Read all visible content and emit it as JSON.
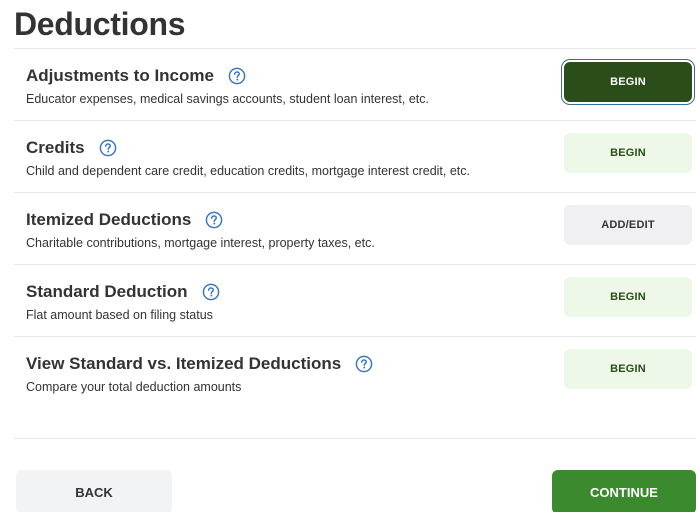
{
  "page": {
    "title": "Deductions"
  },
  "rows": [
    {
      "title": "Adjustments to Income",
      "description": "Educator expenses, medical savings accounts, student loan interest, etc.",
      "action_label": "BEGIN"
    },
    {
      "title": "Credits",
      "description": "Child and dependent care credit, education credits, mortgage interest credit, etc.",
      "action_label": "BEGIN"
    },
    {
      "title": "Itemized Deductions",
      "description": "Charitable contributions, mortgage interest, property taxes, etc.",
      "action_label": "ADD/EDIT"
    },
    {
      "title": "Standard Deduction",
      "description": "Flat amount based on filing status",
      "action_label": "BEGIN"
    },
    {
      "title": "View Standard vs. Itemized Deductions",
      "description": "Compare your total deduction amounts",
      "action_label": "BEGIN"
    }
  ],
  "footer": {
    "back_label": "BACK",
    "continue_label": "CONTINUE"
  },
  "icons": {
    "help": "question-circle-icon"
  },
  "colors": {
    "text": "#333333",
    "help_icon": "#3a78c3",
    "primary_dark": "#2b4d1a",
    "light_green": "#eef8e9",
    "continue_green": "#3c8a2e",
    "gray_button": "#f0f0f3",
    "divider": "#e6e6e6"
  }
}
